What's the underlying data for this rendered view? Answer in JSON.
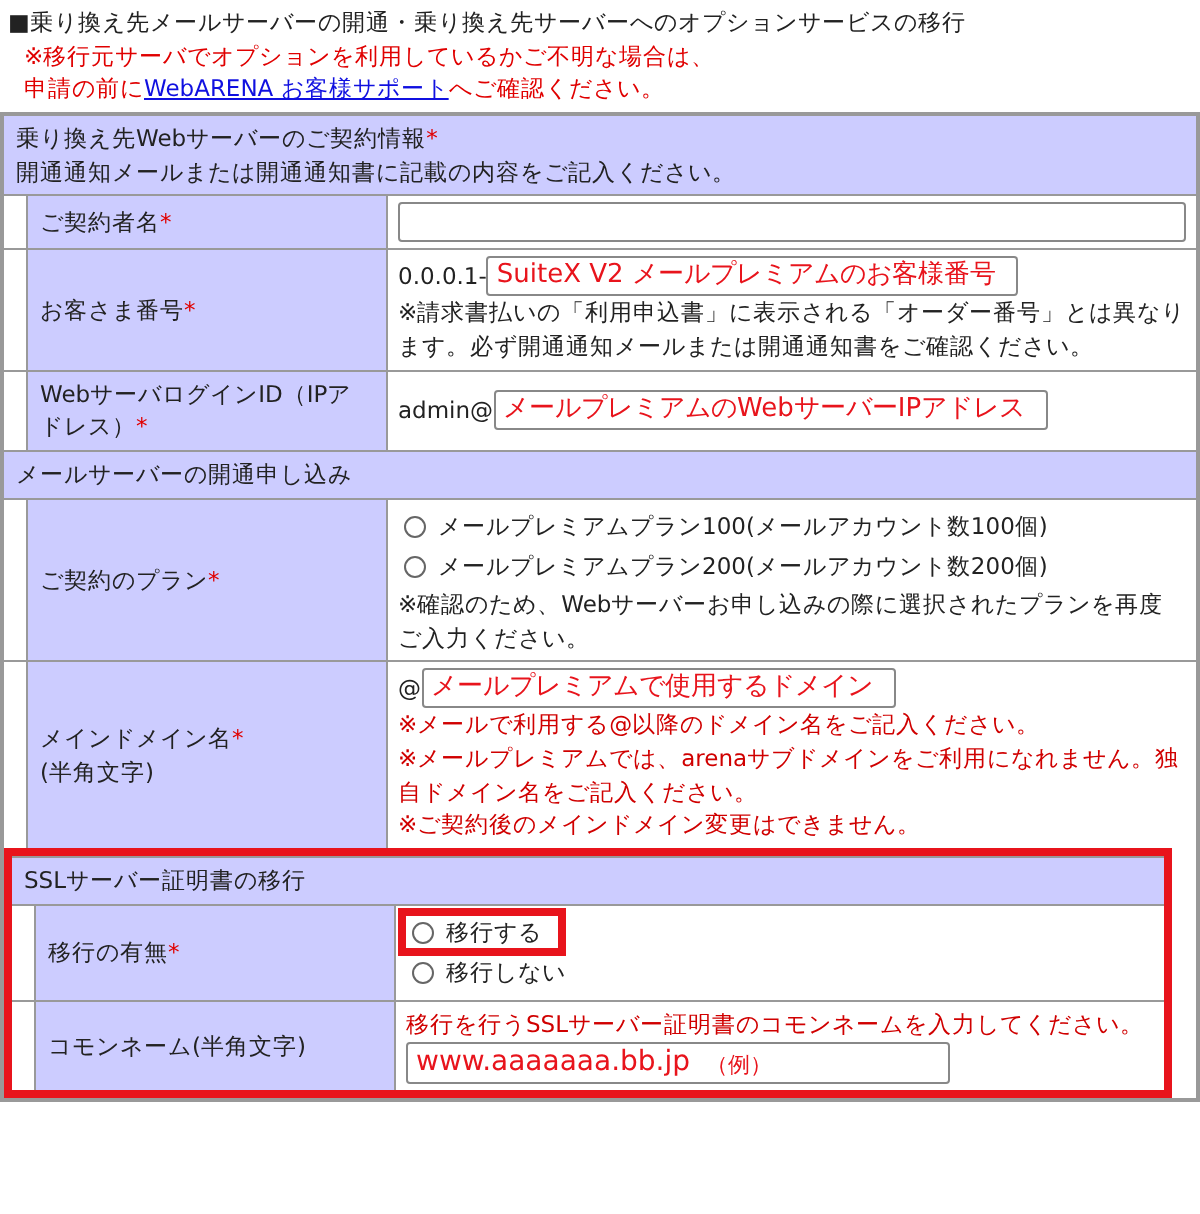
{
  "heading": "■乗り換え先メールサーバーの開通・乗り換え先サーバーへのオプションサービスの移行",
  "notice": {
    "line1": "※移行元サーバでオプションを利用しているかご不明な場合は、",
    "before": "申請の前に",
    "link": "WebARENA お客様サポート",
    "after": "へご確認ください。"
  },
  "sections": [
    {
      "title": "乗り換え先Webサーバーのご契約情報",
      "mark": "*",
      "subtitle": "開通通知メールまたは開通通知書に記載の内容をご記入ください。",
      "highlighted": false,
      "rows": [
        {
          "label": "ご契約者名",
          "mark": "*",
          "items": [
            {
              "kind": "input"
            }
          ]
        },
        {
          "label": "お客さま番号",
          "mark": "*",
          "items": [
            {
              "kind": "input",
              "prefix": "0.0.0.1-",
              "value": "SuiteX V2 メールプレミアムのお客様番号"
            },
            {
              "kind": "note",
              "text": "※請求書払いの「利用申込書」に表示される「オーダー番号」とは異なります。必ず開通通知メールまたは開通通知書をご確認ください。"
            }
          ]
        },
        {
          "label": "WebサーバログインID（IPアドレス）",
          "mark": "*",
          "items": [
            {
              "kind": "input",
              "prefix": "admin@",
              "value": "メールプレミアムのWebサーバーIPアドレス"
            }
          ]
        }
      ]
    },
    {
      "title": "メールサーバーの開通申し込み",
      "highlighted": false,
      "rows": [
        {
          "label": "ご契約のプラン",
          "mark": "*",
          "items": [
            {
              "kind": "radios",
              "options": [
                {
                  "label": "メールプレミアムプラン100(メールアカウント数100個)",
                  "selected": false,
                  "highlighted": false
                },
                {
                  "label": "メールプレミアムプラン200(メールアカウント数200個)",
                  "selected": false,
                  "highlighted": false
                }
              ]
            },
            {
              "kind": "note",
              "text": "※確認のため、Webサーバーお申し込みの際に選択されたプランを再度ご入力ください。"
            }
          ]
        },
        {
          "label": "メインドメイン名",
          "mark": "*",
          "sub": "(半角文字)",
          "items": [
            {
              "kind": "input",
              "prefix": "@",
              "value": "メールプレミアムで使用するドメイン"
            },
            {
              "kind": "warning",
              "text": "※メールで利用する@以降のドメイン名をご記入ください。"
            },
            {
              "kind": "warning",
              "text": "※メールプレミアムでは、arenaサブドメインをご利用になれません。独自ドメイン名をご記入ください。"
            },
            {
              "kind": "warning",
              "text": "※ご契約後のメインドメイン変更はできません。"
            }
          ]
        }
      ]
    },
    {
      "title": "SSLサーバー証明書の移行",
      "highlighted": true,
      "rows": [
        {
          "label": "移行の有無",
          "mark": "*",
          "items": [
            {
              "kind": "radios",
              "options": [
                {
                  "label": "移行する",
                  "selected": false,
                  "highlighted": true
                },
                {
                  "label": "移行しない",
                  "selected": false,
                  "highlighted": false
                }
              ]
            }
          ]
        },
        {
          "label": "コモンネーム(半角文字)",
          "items": [
            {
              "kind": "warning",
              "text": "移行を行うSSLサーバー証明書のコモンネームを入力してください。"
            },
            {
              "kind": "example_input",
              "value": "www.aaaaaaa.bb.jp",
              "example": "（例）"
            }
          ]
        }
      ]
    }
  ]
}
